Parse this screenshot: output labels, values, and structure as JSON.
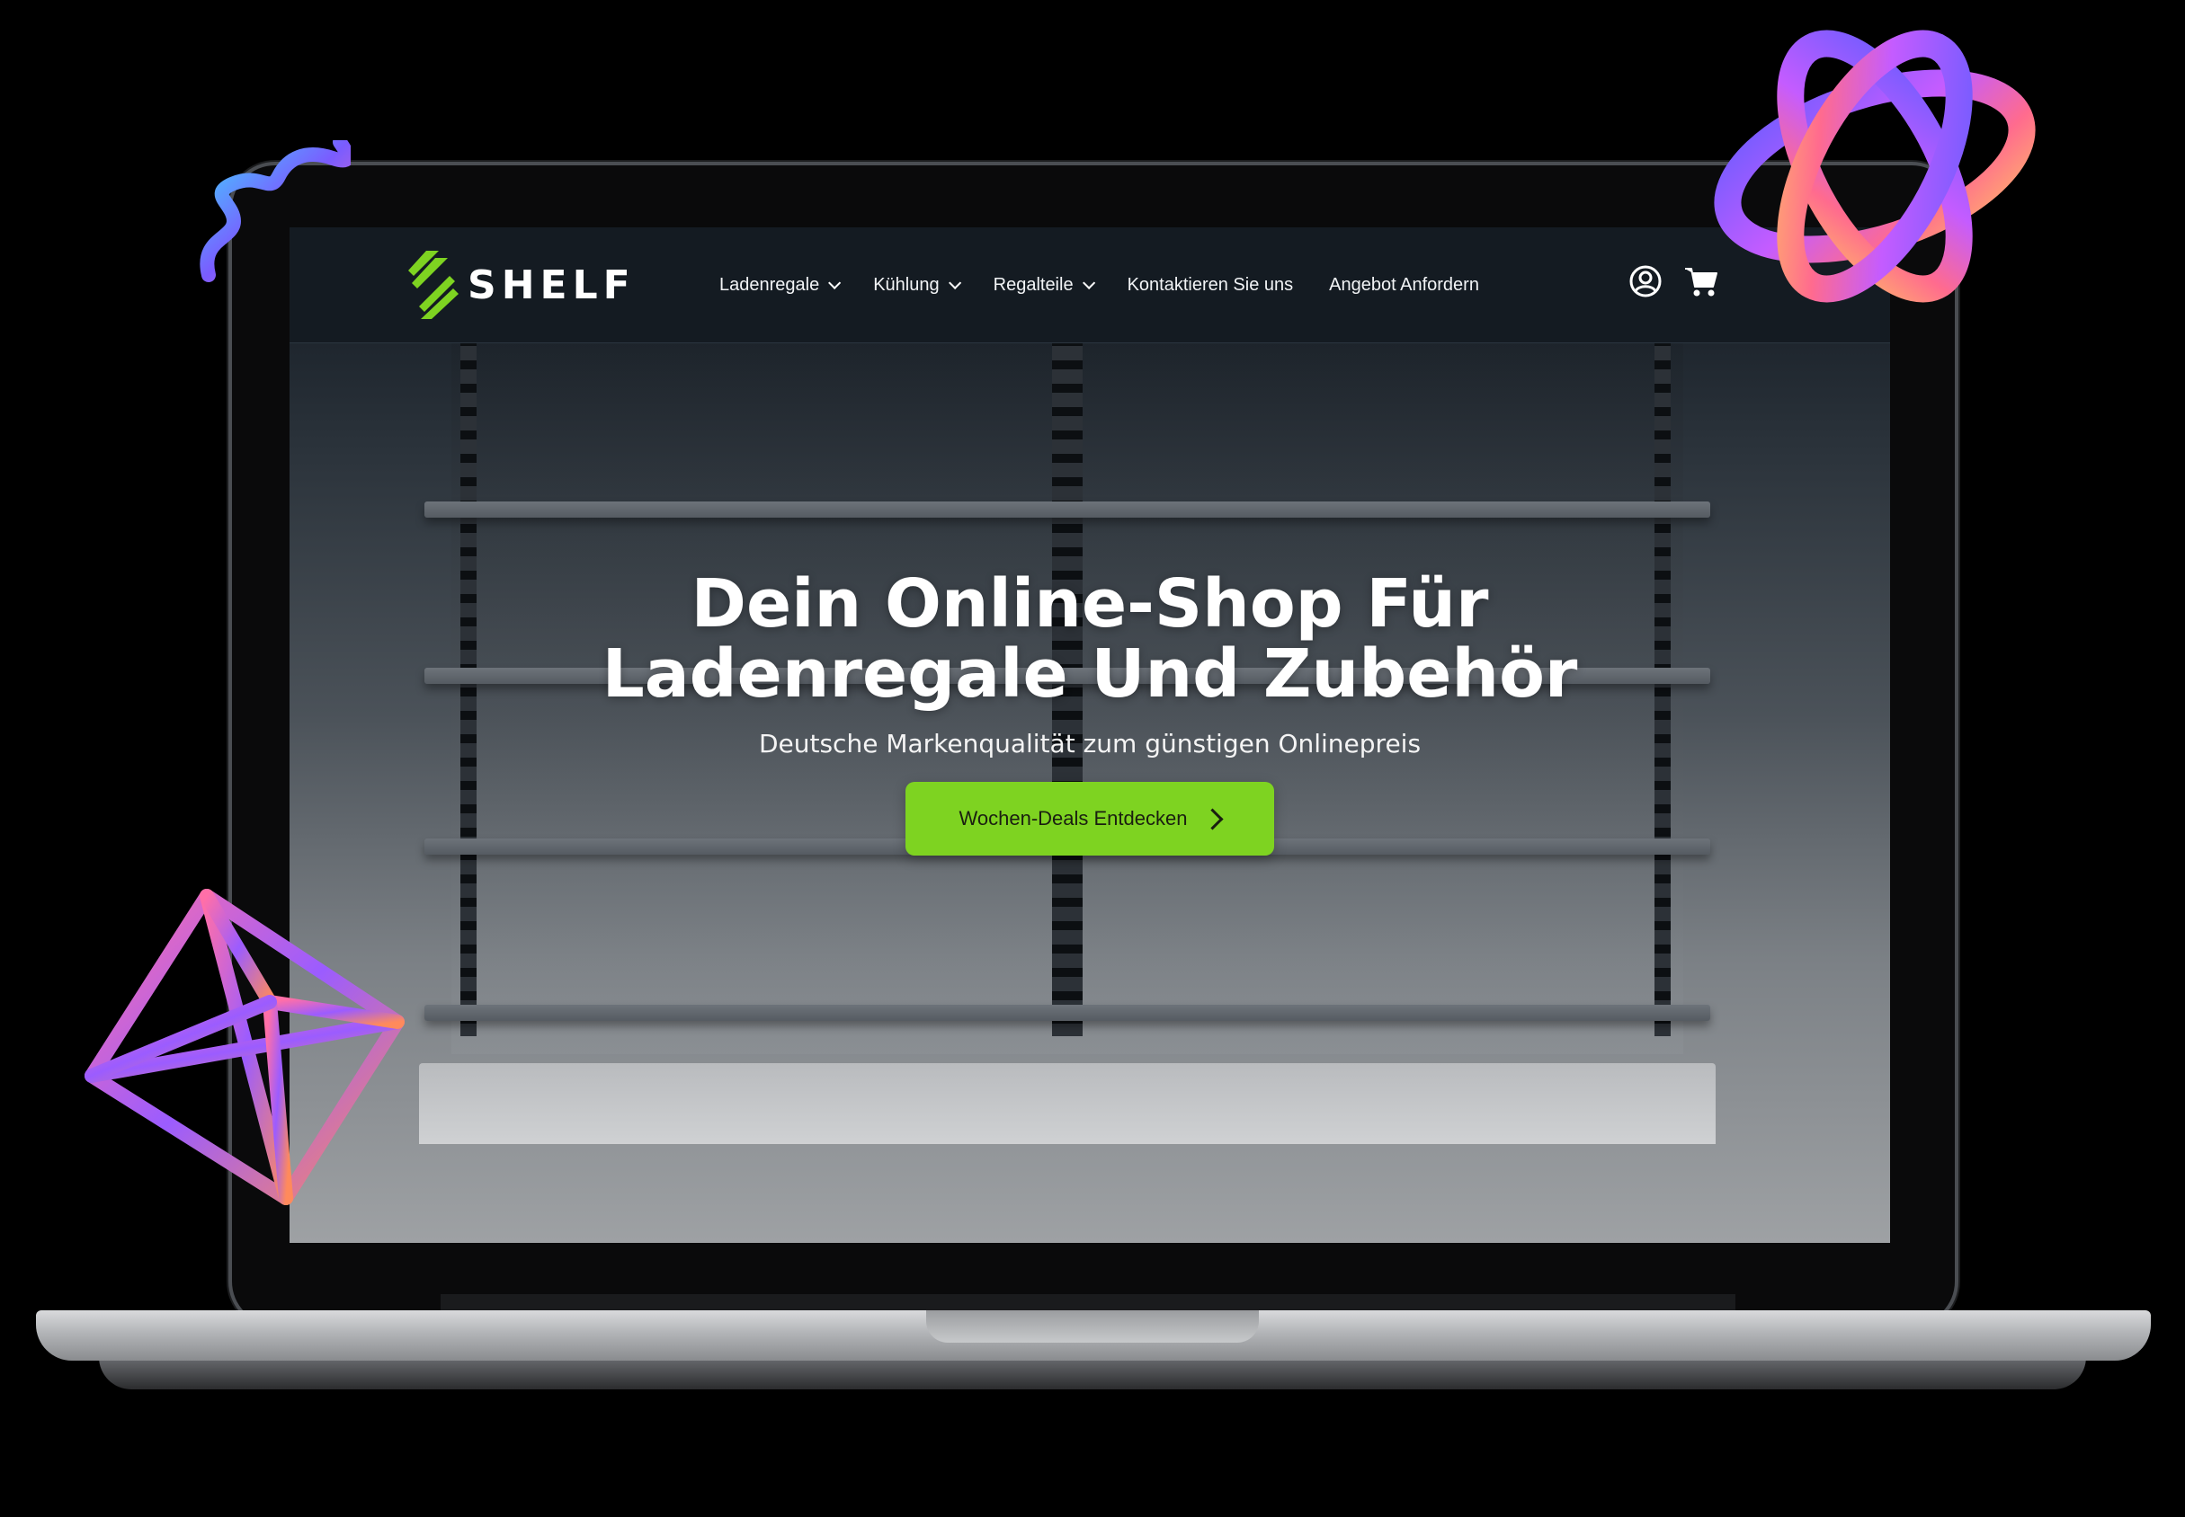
{
  "brand": {
    "name": "SHELF",
    "accent": "#7ed321"
  },
  "nav": {
    "items": [
      {
        "label": "Ladenregale",
        "dropdown": true
      },
      {
        "label": "Kühlung",
        "dropdown": true
      },
      {
        "label": "Regalteile",
        "dropdown": true
      },
      {
        "label": "Kontaktieren Sie uns",
        "dropdown": false
      },
      {
        "label": "Angebot Anfordern",
        "dropdown": false
      }
    ],
    "icons": [
      "user-account-icon",
      "shopping-cart-icon"
    ]
  },
  "hero": {
    "title_line1": "Dein Online-Shop Für",
    "title_line2": "Ladenregale Und Zubehör",
    "subtitle": "Deutsche Markenqualität zum günstigen Onlinepreis",
    "cta_label": "Wochen-Deals Entdecken"
  }
}
